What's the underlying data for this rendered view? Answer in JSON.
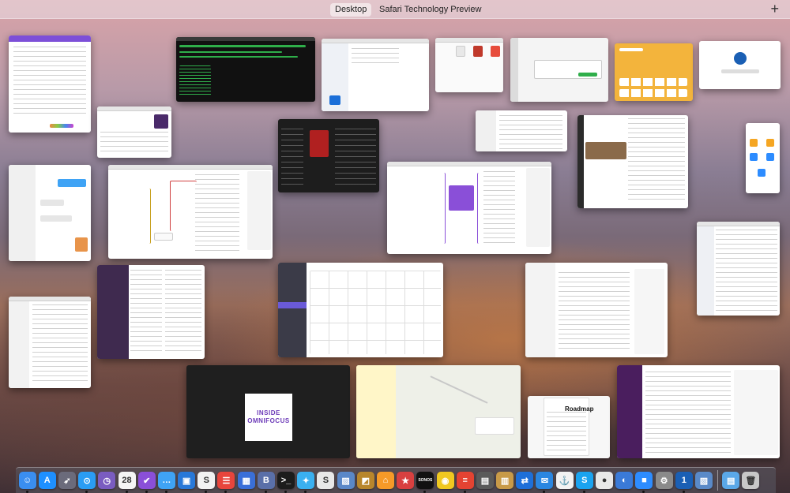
{
  "spaces": {
    "tabs": [
      "Desktop",
      "Safari Technology Preview"
    ],
    "active_index": 0,
    "add_label": "+"
  },
  "windows": {
    "omnifocus_text": [
      "INSIDE",
      "OMNIFOCUS"
    ],
    "roadmap_title": "Roadmap"
  },
  "dock": {
    "icons": [
      {
        "name": "finder-icon",
        "glyph": "☺",
        "color": "#3a8ef0",
        "running": true
      },
      {
        "name": "app-store-icon",
        "glyph": "A",
        "color": "#1e90ff",
        "running": false
      },
      {
        "name": "launchpad-icon",
        "glyph": "➶",
        "color": "#6b6b7b",
        "running": false
      },
      {
        "name": "safari-icon",
        "glyph": "⊙",
        "color": "#2a9df4",
        "running": true
      },
      {
        "name": "clock-icon",
        "glyph": "◷",
        "color": "#7a5cc0",
        "running": false
      },
      {
        "name": "calendar-icon",
        "glyph": "28",
        "color": "#f5f5f5",
        "running": true
      },
      {
        "name": "omnifocus-icon",
        "glyph": "✔",
        "color": "#8a4fd8",
        "running": true
      },
      {
        "name": "messages-icon",
        "glyph": "…",
        "color": "#3fa3f5",
        "running": true
      },
      {
        "name": "screens-icon",
        "glyph": "▣",
        "color": "#2878d8",
        "running": false
      },
      {
        "name": "scrivener-icon",
        "glyph": "S",
        "color": "#f2f2f2",
        "running": true
      },
      {
        "name": "fantastical-icon",
        "glyph": "☰",
        "color": "#e8453c",
        "running": true
      },
      {
        "name": "archive-icon",
        "glyph": "▦",
        "color": "#3a6fd8",
        "running": false
      },
      {
        "name": "bbedit-icon",
        "glyph": "B",
        "color": "#5a6fa8",
        "running": true
      },
      {
        "name": "terminal-icon",
        "glyph": ">_",
        "color": "#1c1c1c",
        "running": true
      },
      {
        "name": "tweetbot-icon",
        "glyph": "✦",
        "color": "#3ab0f0",
        "running": true
      },
      {
        "name": "scrivener-s-icon",
        "glyph": "S",
        "color": "#e8e8e8",
        "running": false
      },
      {
        "name": "image-viewer-icon",
        "glyph": "▨",
        "color": "#5a88c8",
        "running": false
      },
      {
        "name": "photos-edit-icon",
        "glyph": "◩",
        "color": "#b8862c",
        "running": false
      },
      {
        "name": "home-icon",
        "glyph": "⌂",
        "color": "#f59a28",
        "running": false
      },
      {
        "name": "reeder-icon",
        "glyph": "★",
        "color": "#d84040",
        "running": false
      },
      {
        "name": "sonos-icon",
        "glyph": "SONOS",
        "color": "#111111",
        "running": true
      },
      {
        "name": "vision-icon",
        "glyph": "◉",
        "color": "#f0c820",
        "running": false
      },
      {
        "name": "todoist-icon",
        "glyph": "≡",
        "color": "#e44332",
        "running": true
      },
      {
        "name": "notebook-icon",
        "glyph": "▤",
        "color": "#5a5a5a",
        "running": false
      },
      {
        "name": "sketchbook-icon",
        "glyph": "▥",
        "color": "#c89a48",
        "running": false
      },
      {
        "name": "teamviewer-icon",
        "glyph": "⇄",
        "color": "#1e6fd8",
        "running": false
      },
      {
        "name": "airmail-icon",
        "glyph": "✉",
        "color": "#2a86e0",
        "running": true
      },
      {
        "name": "anchor-icon",
        "glyph": "⚓",
        "color": "#f2f2f2",
        "running": false
      },
      {
        "name": "skype-icon",
        "glyph": "S",
        "color": "#1aa3f0",
        "running": true
      },
      {
        "name": "ball-icon",
        "glyph": "●",
        "color": "#e8e8e8",
        "running": false
      },
      {
        "name": "browser-icon",
        "glyph": "◐",
        "color": "#3a7ad8",
        "running": false
      },
      {
        "name": "zoom-icon",
        "glyph": "■",
        "color": "#2d8cff",
        "running": true
      },
      {
        "name": "system-preferences-icon",
        "glyph": "⚙",
        "color": "#8a8a8a",
        "running": false
      },
      {
        "name": "1password-icon",
        "glyph": "1",
        "color": "#1a5fb4",
        "running": true
      },
      {
        "name": "preview-icon",
        "glyph": "▨",
        "color": "#5a8ac8",
        "running": false
      }
    ],
    "right_icons": [
      {
        "name": "downloads-folder-icon",
        "glyph": "▤",
        "color": "#5aa8e8"
      },
      {
        "name": "trash-icon",
        "glyph": "🗑",
        "color": "#c8c8c8"
      }
    ]
  }
}
